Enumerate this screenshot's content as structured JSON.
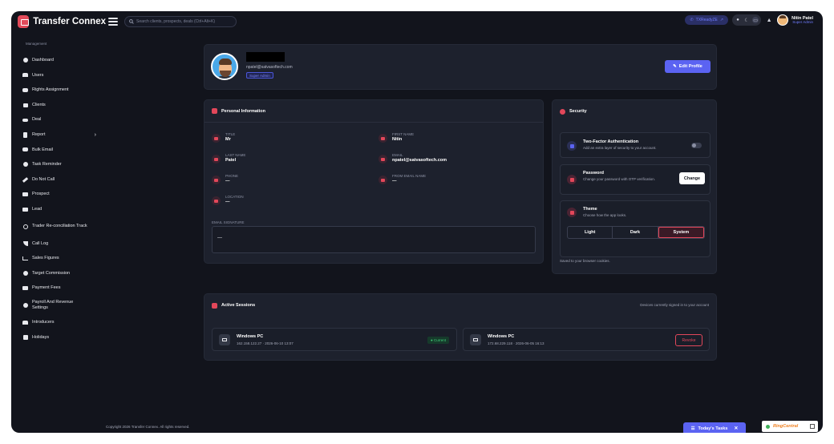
{
  "app": {
    "name": "Transfer Connex"
  },
  "search": {
    "placeholder": "Search clients, prospects, deals (Ctrl+Alt+K)"
  },
  "topbar": {
    "extension_label": "TXReadyZE",
    "user_name": "Nitin Patel",
    "user_role": "Super Admin"
  },
  "sidebar": {
    "section": "Management",
    "items": [
      {
        "label": "Dashboard",
        "icon": "dashboard-icon"
      },
      {
        "label": "Users",
        "icon": "users-icon"
      },
      {
        "label": "Rights Assignment",
        "icon": "user-shield-icon"
      },
      {
        "label": "Clients",
        "icon": "clients-icon"
      },
      {
        "label": "Deal",
        "icon": "handshake-icon"
      },
      {
        "label": "Report",
        "icon": "report-icon"
      },
      {
        "label": "Bulk Email",
        "icon": "bulk-email-icon"
      },
      {
        "label": "Task Reminder",
        "icon": "clock-icon"
      },
      {
        "label": "Do Not Call",
        "icon": "phone-slash-icon"
      },
      {
        "label": "Prospect",
        "icon": "prospect-icon"
      },
      {
        "label": "Lead",
        "icon": "lead-icon"
      },
      {
        "label": "Trader Re-conciliation Track",
        "icon": "sync-icon"
      },
      {
        "label": "Call Log",
        "icon": "phone-icon"
      },
      {
        "label": "Sales Figures",
        "icon": "chart-line-icon"
      },
      {
        "label": "Target Commission",
        "icon": "target-icon"
      },
      {
        "label": "Payment Fees",
        "icon": "credit-card-icon"
      },
      {
        "label": "Payroll And Revenue Settings",
        "icon": "cogs-icon"
      },
      {
        "label": "Introducers",
        "icon": "people-icon"
      },
      {
        "label": "Holidays",
        "icon": "calendar-icon"
      }
    ]
  },
  "profile": {
    "email": "npatel@satvasoftech.com",
    "role": "Super Admin",
    "edit_label": "Edit Profile"
  },
  "personal": {
    "title": "Personal Information",
    "fields": {
      "title_label": "TITLE",
      "title_value": "Mr",
      "first_label": "FIRST NAME",
      "first_value": "Nitin",
      "last_label": "LAST NAME",
      "last_value": "Patel",
      "email_label": "EMAIL",
      "email_value": "npatel@satvasoftech.com",
      "phone_label": "PHONE",
      "phone_value": "—",
      "from_label": "FROM EMAIL NAME",
      "from_value": "—",
      "location_label": "LOCATION",
      "location_value": "—"
    },
    "signature_label": "EMAIL SIGNATURE",
    "signature_value": "—"
  },
  "security": {
    "title": "Security",
    "twofa_title": "Two-Factor Authentication",
    "twofa_desc": "Add an extra layer of security to your account.",
    "password_title": "Password",
    "password_desc": "Change your password with OTP verification.",
    "change_label": "Change",
    "theme_title": "Theme",
    "theme_desc": "Choose how the app looks.",
    "theme_options": [
      "Light",
      "Dark",
      "System"
    ],
    "theme_selected": "System",
    "theme_note": "Saved to your browser cookies."
  },
  "sessions": {
    "title": "Active Sessions",
    "subtitle": "Devices currently signed in to your account",
    "items": [
      {
        "device": "Windows PC",
        "meta": "162.158.122.27 · 2026-06-10 13:07",
        "status": "● Current"
      },
      {
        "device": "Windows PC",
        "meta": "172.68.229.118 · 2026-06-05 16:13",
        "action": "Revoke"
      }
    ]
  },
  "footer": {
    "copyright": "Copyright 2026 Transfer Connex. All rights reserved."
  },
  "widgets": {
    "tasks_label": "Today's Tasks",
    "ringcentral": "RingCentral"
  },
  "colors": {
    "accent": "#5b63f2",
    "danger": "#e2475a",
    "success": "#3fd07a",
    "bg": "#12141c",
    "card": "#1d212d"
  }
}
